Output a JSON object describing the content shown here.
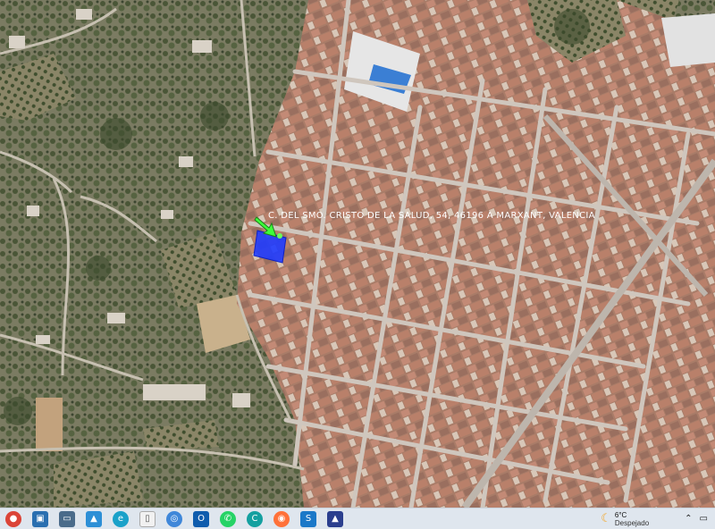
{
  "map": {
    "placemark_label": "C. DEL SMO. CRISTO DE LA SALUD, 54, 46196 A MARXANT, VALENCIA",
    "roof_color": "#b7856d",
    "vegetation_color": "#5f6e48",
    "selection_color": "#1f3cff",
    "arrow_color": "#3dff3a"
  },
  "taskbar": {
    "apps": [
      {
        "name": "start-button",
        "icon": "chrome-style-icon",
        "color": "#db4437"
      },
      {
        "name": "taskbar-app-1",
        "icon": "window-icon",
        "color": "#2a6fb0"
      },
      {
        "name": "taskbar-app-2",
        "icon": "window-icon",
        "color": "#4a6b8a"
      },
      {
        "name": "taskbar-app-3",
        "icon": "photos-icon",
        "color": "#2d8fd6"
      },
      {
        "name": "taskbar-app-4",
        "icon": "edge-icon",
        "color": "#1aa1c9"
      },
      {
        "name": "taskbar-app-5",
        "icon": "file-icon",
        "color": "#f1f1f1"
      },
      {
        "name": "taskbar-app-6",
        "icon": "globe-icon",
        "color": "#3f87d9"
      },
      {
        "name": "taskbar-app-7",
        "icon": "outlook-icon",
        "color": "#0f5cad"
      },
      {
        "name": "taskbar-app-8",
        "icon": "whatsapp-icon",
        "color": "#25d366"
      },
      {
        "name": "taskbar-app-9",
        "icon": "c-icon",
        "color": "#14a0a0"
      },
      {
        "name": "taskbar-app-10",
        "icon": "firefox-icon",
        "color": "#ff7139"
      },
      {
        "name": "taskbar-app-11",
        "icon": "s-icon",
        "color": "#1b78c8"
      },
      {
        "name": "taskbar-app-12",
        "icon": "a-icon",
        "color": "#2b3f8e"
      }
    ],
    "weather": {
      "temp": "6°C",
      "condition": "Despejado"
    }
  }
}
